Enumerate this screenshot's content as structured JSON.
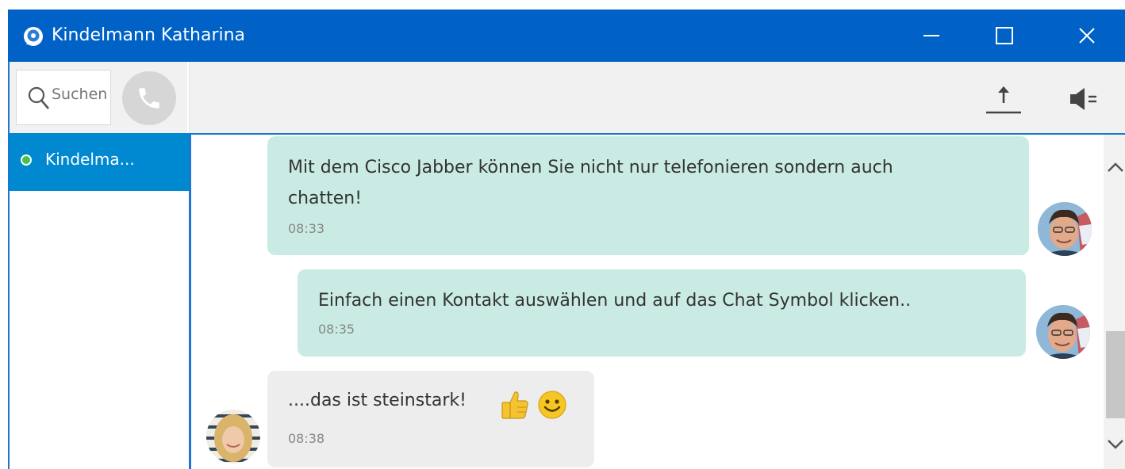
{
  "window": {
    "title": "Kindelmann Katharina",
    "controls": [
      "minimize",
      "maximize",
      "close"
    ]
  },
  "search": {
    "placeholder": "Suchen"
  },
  "call_button": {
    "icon": "phone-icon"
  },
  "contacts": [
    {
      "name": "Kindelma...",
      "status": "available",
      "status_color": "#41c542",
      "selected": true
    }
  ],
  "toolbar": {
    "icons": [
      "file-upload-icon",
      "audio-settings-icon"
    ]
  },
  "messages": [
    {
      "sender": "self",
      "text_line1": "Mit dem Cisco Jabber können Sie nicht nur telefonieren sondern auch",
      "text_line2": "chatten!",
      "time": "08:33"
    },
    {
      "sender": "self",
      "text": "Einfach einen Kontakt auswählen und auf das Chat Symbol klicken..",
      "time": "08:35"
    },
    {
      "sender": "contact",
      "text": "....das ist steinstark!",
      "emoji": [
        "thumbs-up-icon",
        "smiley-icon"
      ],
      "time": "08:38"
    }
  ],
  "colors": {
    "titlebar": "#0061c6",
    "selected_contact": "#0089d1",
    "outgoing_bubble": "#c9ebe3",
    "incoming_bubble": "#ededed",
    "accent_border": "#1d76d2"
  }
}
